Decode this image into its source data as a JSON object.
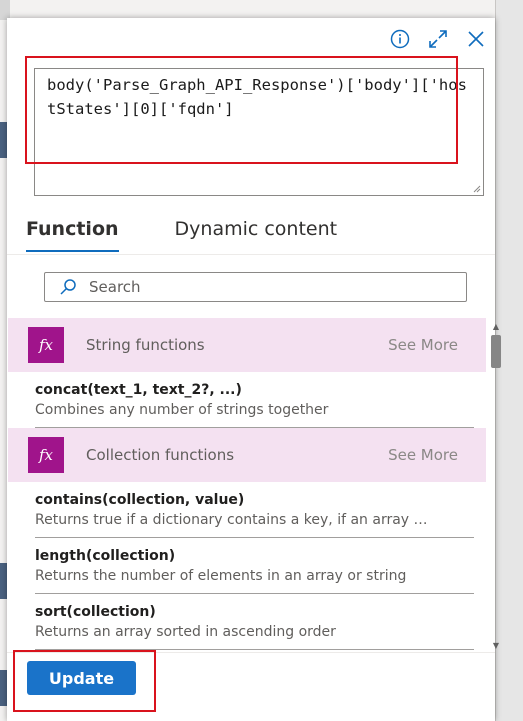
{
  "header": {
    "info_icon": "info-icon",
    "expand_icon": "expand-icon",
    "close_icon": "close-icon"
  },
  "expression": {
    "value": "body('Parse_Graph_API_Response')['body']['hostStates'][0]['fqdn']"
  },
  "tabs": [
    {
      "label": "Function",
      "active": true
    },
    {
      "label": "Dynamic content",
      "active": false
    }
  ],
  "search": {
    "placeholder": "Search"
  },
  "categories": [
    {
      "label": "String functions",
      "see_more": "See More",
      "icon": "fx",
      "functions": [
        {
          "name": "concat(text_1, text_2?, ...)",
          "desc": "Combines any number of strings together"
        }
      ]
    },
    {
      "label": "Collection functions",
      "see_more": "See More",
      "icon": "fx",
      "functions": [
        {
          "name": "contains(collection, value)",
          "desc": "Returns true if a dictionary contains a key, if an array con..."
        },
        {
          "name": "length(collection)",
          "desc": "Returns the number of elements in an array or string"
        },
        {
          "name": "sort(collection)",
          "desc": "Returns an array sorted in ascending order"
        }
      ]
    }
  ],
  "footer": {
    "update_label": "Update"
  },
  "colors": {
    "accent": "#1a73c9",
    "fx_bg": "#a0148b",
    "category_bg": "#f4e1f1",
    "highlight": "#d9131d"
  }
}
